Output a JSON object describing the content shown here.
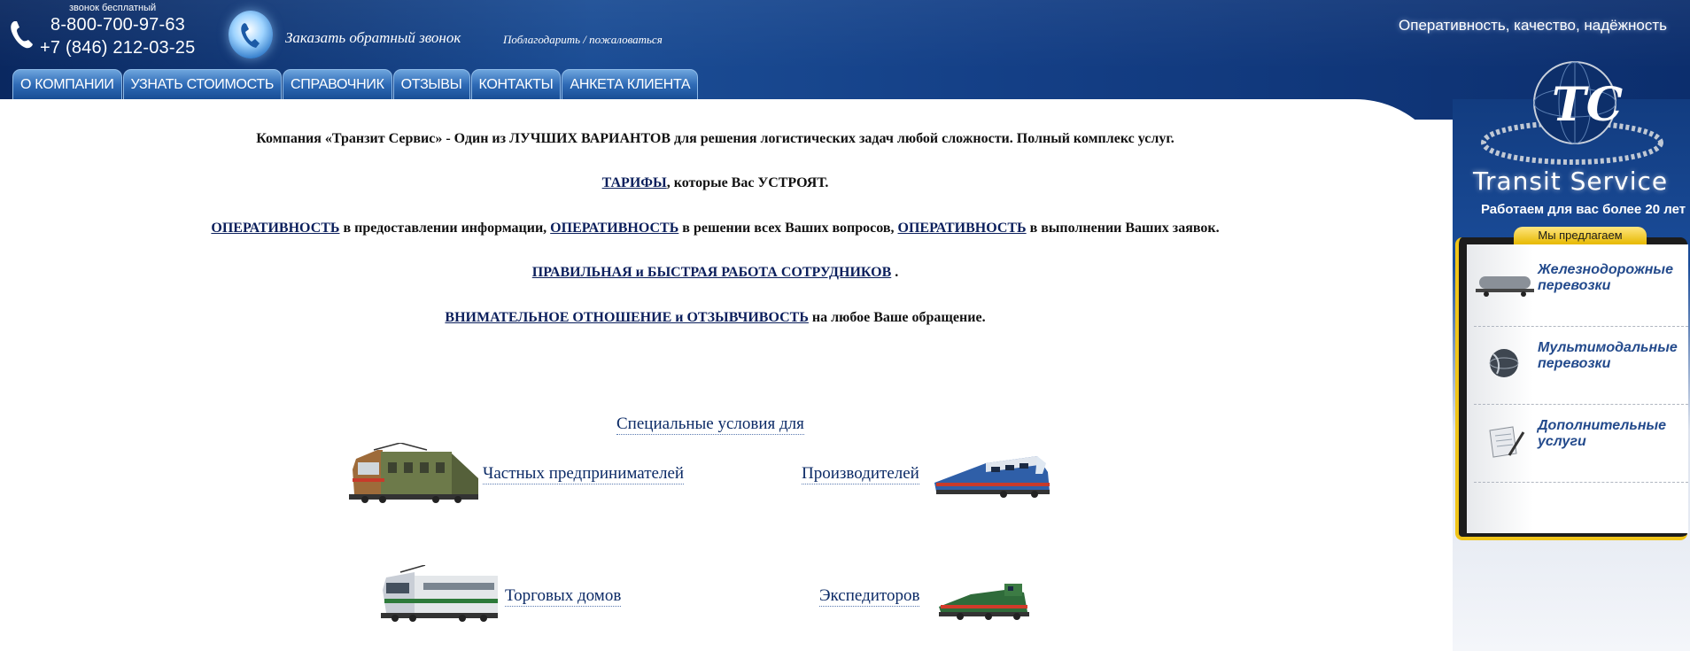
{
  "header": {
    "free_call_label": "звонок бесплатный",
    "phone1": "8-800-700-97-63",
    "phone2": "+7 (846) 212-03-25",
    "callback_link": "Заказать обратный звонок",
    "thanks_link": "Поблагодарить / пожаловаться",
    "slogan": "Оперативность, качество, надёжность"
  },
  "nav": {
    "items": [
      {
        "label": "О КОМПАНИИ"
      },
      {
        "label": "УЗНАТЬ СТОИМОСТЬ"
      },
      {
        "label": "СПРАВОЧНИК"
      },
      {
        "label": "ОТЗЫВЫ"
      },
      {
        "label": "КОНТАКТЫ"
      },
      {
        "label": "АНКЕТА КЛИЕНТА"
      }
    ]
  },
  "main": {
    "line1": "Компания «Транзит Сервис» - Один из ЛУЧШИХ ВАРИАНТОВ  для  решения логистических задач любой сложности. Полный комплекс услуг.",
    "line2_link": "ТАРИФЫ",
    "line2_rest": ",  которые  Вас  УСТРОЯТ.",
    "line3_link1": "ОПЕРАТИВНОСТЬ",
    "line3_text1": " в предоставлении информации, ",
    "line3_link2": "ОПЕРАТИВНОСТЬ",
    "line3_text2": " в решении всех Ваших вопросов, ",
    "line3_link3": "ОПЕРАТИВНОСТЬ",
    "line3_text3": " в выполнении Ваших заявок.",
    "line4_link": "ПРАВИЛЬНАЯ  и  БЫСТРАЯ  РАБОТА  СОТРУДНИКОВ",
    "line4_rest": " .",
    "line5_link": "ВНИМАТЕЛЬНОЕ  ОТНОШЕНИЕ  и ОТЗЫВЧИВОСТЬ",
    "line5_rest": " на любое Ваше обращение.",
    "special_title": "Специальные условия для",
    "segments": [
      {
        "label": "Частных предпринимателей"
      },
      {
        "label": "Производителей"
      },
      {
        "label": "Торговых домов"
      },
      {
        "label": "Экспедиторов"
      }
    ]
  },
  "sidebar": {
    "brand": "Transit Service",
    "logo_letters": "ТС",
    "years": "Работаем для вас более 20 лет",
    "offer_title": "Мы предлагаем",
    "offers": [
      {
        "line1": "Железнодорожные",
        "line2": "перевозки"
      },
      {
        "line1": "Мультимодальные",
        "line2": "перевозки"
      },
      {
        "line1": "Дополнительные",
        "line2": "услуги"
      }
    ]
  },
  "colors": {
    "header_dark": "#0a2860",
    "header_mid": "#1b4d95",
    "accent_yellow": "#f0c419",
    "link_blue": "#0b2a66",
    "offer_text": "#234a8c"
  }
}
